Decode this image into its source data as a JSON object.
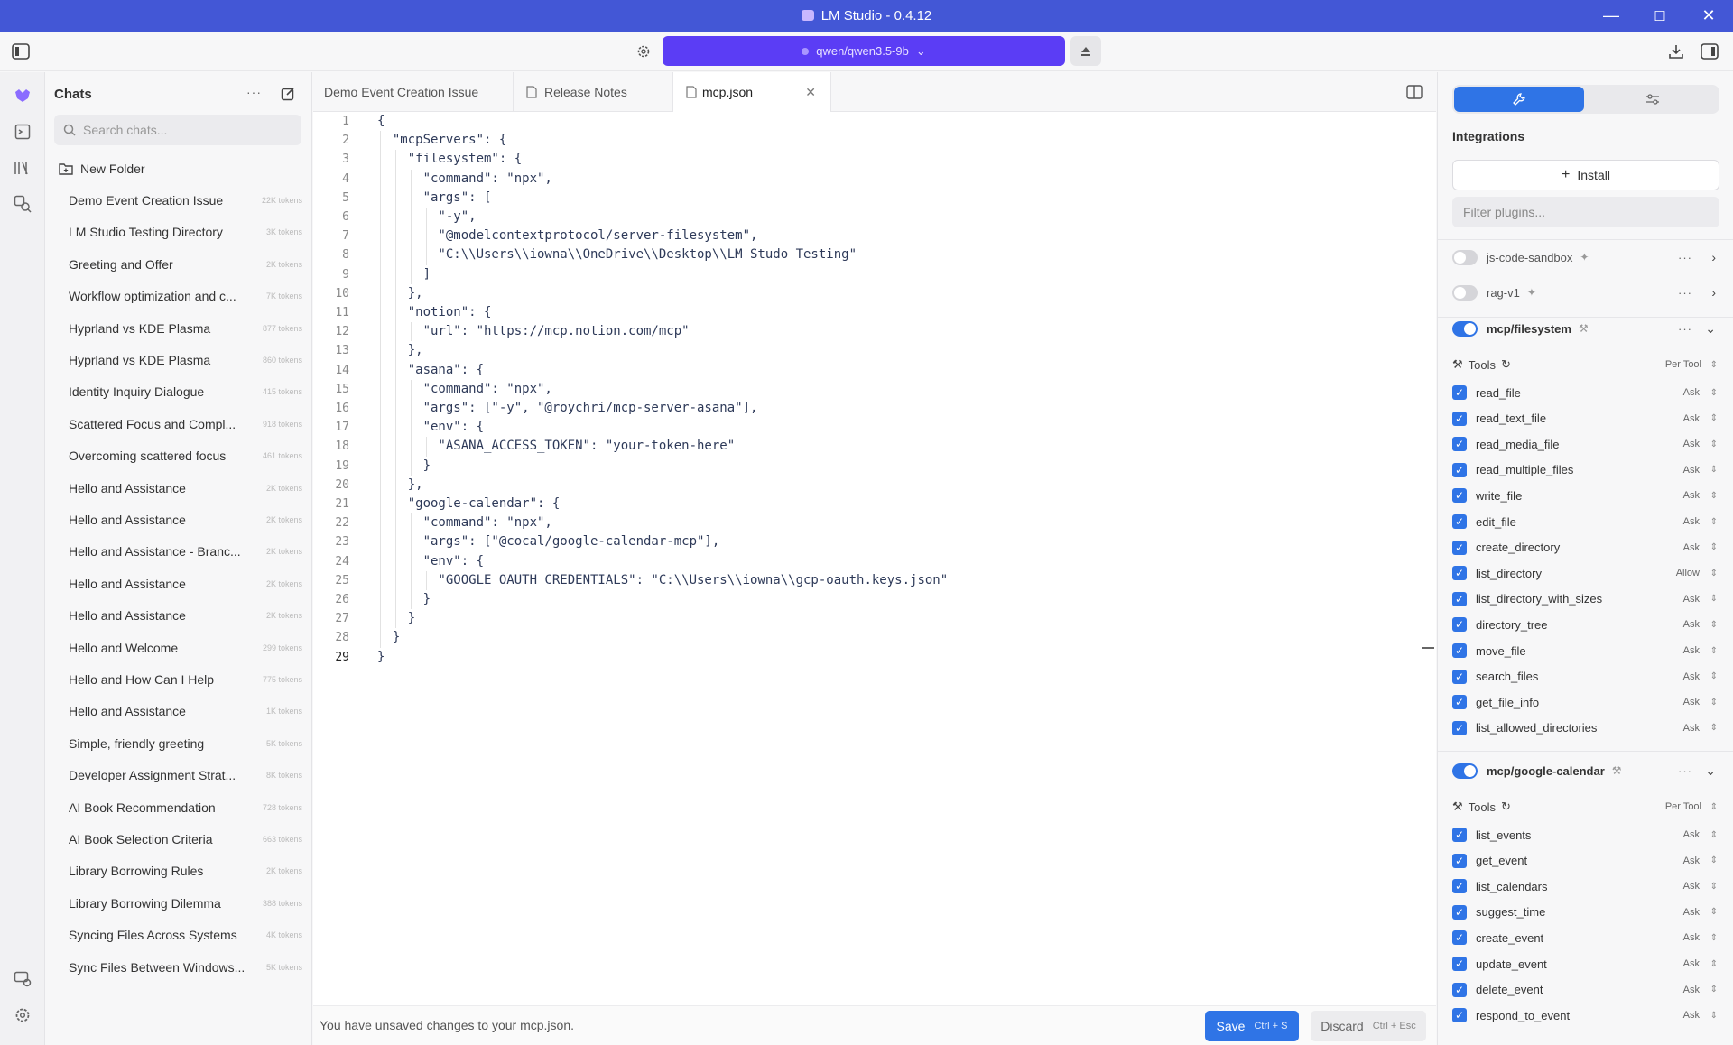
{
  "window": {
    "title": "LM Studio - 0.4.12",
    "minimize": "—",
    "maximize": "☐",
    "close": "✕"
  },
  "toolbar": {
    "model": "qwen/qwen3.5-9b"
  },
  "chats": {
    "header": "Chats",
    "search_placeholder": "Search chats...",
    "new_folder": "New Folder",
    "items": [
      {
        "title": "Demo Event Creation Issue",
        "tokens": "22K tokens"
      },
      {
        "title": "LM Studio Testing Directory",
        "tokens": "3K tokens"
      },
      {
        "title": "Greeting and Offer",
        "tokens": "2K tokens"
      },
      {
        "title": "Workflow optimization and c...",
        "tokens": "7K tokens"
      },
      {
        "title": "Hyprland vs KDE Plasma",
        "tokens": "877 tokens"
      },
      {
        "title": "Hyprland vs KDE Plasma",
        "tokens": "860 tokens"
      },
      {
        "title": "Identity Inquiry Dialogue",
        "tokens": "415 tokens"
      },
      {
        "title": "Scattered Focus and Compl...",
        "tokens": "918 tokens"
      },
      {
        "title": "Overcoming scattered focus",
        "tokens": "461 tokens"
      },
      {
        "title": "Hello and Assistance",
        "tokens": "2K tokens"
      },
      {
        "title": "Hello and Assistance",
        "tokens": "2K tokens"
      },
      {
        "title": "Hello and Assistance - Branc...",
        "tokens": "2K tokens"
      },
      {
        "title": "Hello and Assistance",
        "tokens": "2K tokens"
      },
      {
        "title": "Hello and Assistance",
        "tokens": "2K tokens"
      },
      {
        "title": "Hello and Welcome",
        "tokens": "299 tokens"
      },
      {
        "title": "Hello and How Can I Help",
        "tokens": "775 tokens"
      },
      {
        "title": "Hello and Assistance",
        "tokens": "1K tokens"
      },
      {
        "title": "Simple, friendly greeting",
        "tokens": "5K tokens"
      },
      {
        "title": "Developer Assignment Strat...",
        "tokens": "8K tokens"
      },
      {
        "title": "AI Book Recommendation",
        "tokens": "728 tokens"
      },
      {
        "title": "AI Book Selection Criteria",
        "tokens": "663 tokens"
      },
      {
        "title": "Library Borrowing Rules",
        "tokens": "2K tokens"
      },
      {
        "title": "Library Borrowing Dilemma",
        "tokens": "388 tokens"
      },
      {
        "title": "Syncing Files Across Systems",
        "tokens": "4K tokens"
      },
      {
        "title": "Sync Files Between Windows...",
        "tokens": "5K tokens"
      }
    ]
  },
  "tabs": [
    {
      "label": "Demo Event Creation Issue"
    },
    {
      "label": "Release Notes"
    },
    {
      "label": "mcp.json"
    }
  ],
  "code_lines": [
    "{",
    "  \"mcpServers\": {",
    "    \"filesystem\": {",
    "      \"command\": \"npx\",",
    "      \"args\": [",
    "        \"-y\",",
    "        \"@modelcontextprotocol/server-filesystem\",",
    "        \"C:\\\\Users\\\\iowna\\\\OneDrive\\\\Desktop\\\\LM Studo Testing\"",
    "      ]",
    "    },",
    "    \"notion\": {",
    "      \"url\": \"https://mcp.notion.com/mcp\"",
    "    },",
    "    \"asana\": {",
    "      \"command\": \"npx\",",
    "      \"args\": [\"-y\", \"@roychri/mcp-server-asana\"],",
    "      \"env\": {",
    "        \"ASANA_ACCESS_TOKEN\": \"your-token-here\"",
    "      }",
    "    },",
    "    \"google-calendar\": {",
    "      \"command\": \"npx\",",
    "      \"args\": [\"@cocal/google-calendar-mcp\"],",
    "      \"env\": {",
    "        \"GOOGLE_OAUTH_CREDENTIALS\": \"C:\\\\Users\\\\iowna\\\\gcp-oauth.keys.json\"",
    "      }",
    "    }",
    "  }",
    "}"
  ],
  "status": {
    "message": "You have unsaved changes to your mcp.json.",
    "save": "Save",
    "save_kbd": "Ctrl + S",
    "discard": "Discard",
    "discard_kbd": "Ctrl + Esc"
  },
  "integrations": {
    "title": "Integrations",
    "install": "Install",
    "filter_placeholder": "Filter plugins...",
    "tools_label": "Tools",
    "per_tool": "Per Tool",
    "plugins": [
      {
        "name": "js-code-sandbox",
        "enabled": false
      },
      {
        "name": "rag-v1",
        "enabled": false
      },
      {
        "name": "mcp/filesystem",
        "enabled": true
      },
      {
        "name": "mcp/google-calendar",
        "enabled": true
      }
    ],
    "filesystem_tools": [
      {
        "name": "read_file",
        "perm": "Ask"
      },
      {
        "name": "read_text_file",
        "perm": "Ask"
      },
      {
        "name": "read_media_file",
        "perm": "Ask"
      },
      {
        "name": "read_multiple_files",
        "perm": "Ask"
      },
      {
        "name": "write_file",
        "perm": "Ask"
      },
      {
        "name": "edit_file",
        "perm": "Ask"
      },
      {
        "name": "create_directory",
        "perm": "Ask"
      },
      {
        "name": "list_directory",
        "perm": "Allow"
      },
      {
        "name": "list_directory_with_sizes",
        "perm": "Ask"
      },
      {
        "name": "directory_tree",
        "perm": "Ask"
      },
      {
        "name": "move_file",
        "perm": "Ask"
      },
      {
        "name": "search_files",
        "perm": "Ask"
      },
      {
        "name": "get_file_info",
        "perm": "Ask"
      },
      {
        "name": "list_allowed_directories",
        "perm": "Ask"
      }
    ],
    "calendar_tools": [
      {
        "name": "list_events",
        "perm": "Ask"
      },
      {
        "name": "get_event",
        "perm": "Ask"
      },
      {
        "name": "list_calendars",
        "perm": "Ask"
      },
      {
        "name": "suggest_time",
        "perm": "Ask"
      },
      {
        "name": "create_event",
        "perm": "Ask"
      },
      {
        "name": "update_event",
        "perm": "Ask"
      },
      {
        "name": "delete_event",
        "perm": "Ask"
      },
      {
        "name": "respond_to_event",
        "perm": "Ask"
      }
    ]
  }
}
